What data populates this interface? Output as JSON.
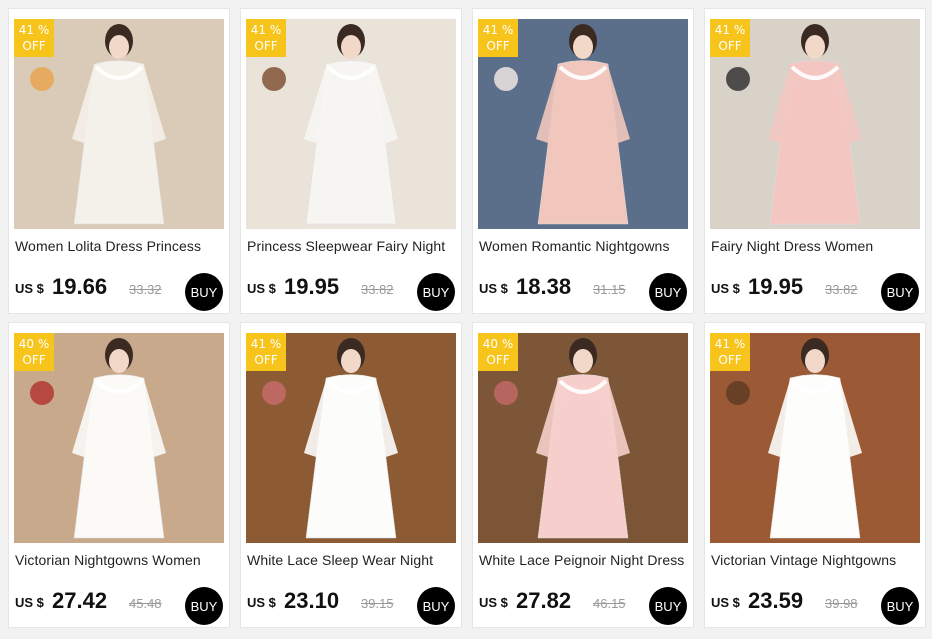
{
  "products": [
    {
      "discount": "41 %",
      "off": "OFF",
      "title": "Women Lolita Dress Princess",
      "currency": "US $",
      "price": "19.66",
      "original": "33.32",
      "buy": "BUY",
      "palette": {
        "bg": "#d9cbb8",
        "dress": "#f4f0ea",
        "accent": "#e8a34a"
      }
    },
    {
      "discount": "41 %",
      "off": "OFF",
      "title": "Princess Sleepwear Fairy Night",
      "currency": "US $",
      "price": "19.95",
      "original": "33.82",
      "buy": "BUY",
      "palette": {
        "bg": "#e9e3da",
        "dress": "#f7f5f2",
        "accent": "#7a4a2a"
      }
    },
    {
      "discount": "41 %",
      "off": "OFF",
      "title": "Women Romantic Nightgowns",
      "currency": "US $",
      "price": "18.38",
      "original": "31.15",
      "buy": "BUY",
      "palette": {
        "bg": "#5b6f8a",
        "dress": "#f1c7bd",
        "accent": "#f7ece6"
      }
    },
    {
      "discount": "41 %",
      "off": "OFF",
      "title": "Fairy Night Dress Women",
      "currency": "US $",
      "price": "19.95",
      "original": "33.82",
      "buy": "BUY",
      "palette": {
        "bg": "#d8d2c8",
        "dress": "#f3c6c2",
        "accent": "#2a2a2a"
      }
    },
    {
      "discount": "40 %",
      "off": "OFF",
      "title": "Victorian Nightgowns Women",
      "currency": "US $",
      "price": "27.42",
      "original": "45.48",
      "buy": "BUY",
      "palette": {
        "bg": "#c9a98c",
        "dress": "#fbfaf7",
        "accent": "#b0302c"
      }
    },
    {
      "discount": "41 %",
      "off": "OFF",
      "title": "White Lace Sleep Wear Night",
      "currency": "US $",
      "price": "23.10",
      "original": "39.15",
      "buy": "BUY",
      "palette": {
        "bg": "#8c5a33",
        "dress": "#fcfcfb",
        "accent": "#c96b6b"
      }
    },
    {
      "discount": "40 %",
      "off": "OFF",
      "title": "White Lace Peignoir Night Dress",
      "currency": "US $",
      "price": "27.82",
      "original": "46.15",
      "buy": "BUY",
      "palette": {
        "bg": "#7c5636",
        "dress": "#f6cfcc",
        "accent": "#c46a6a"
      }
    },
    {
      "discount": "41 %",
      "off": "OFF",
      "title": "Victorian Vintage Nightgowns",
      "currency": "US $",
      "price": "23.59",
      "original": "39.98",
      "buy": "BUY",
      "palette": {
        "bg": "#9b5a35",
        "dress": "#fdfdfc",
        "accent": "#5a3a22"
      }
    }
  ]
}
